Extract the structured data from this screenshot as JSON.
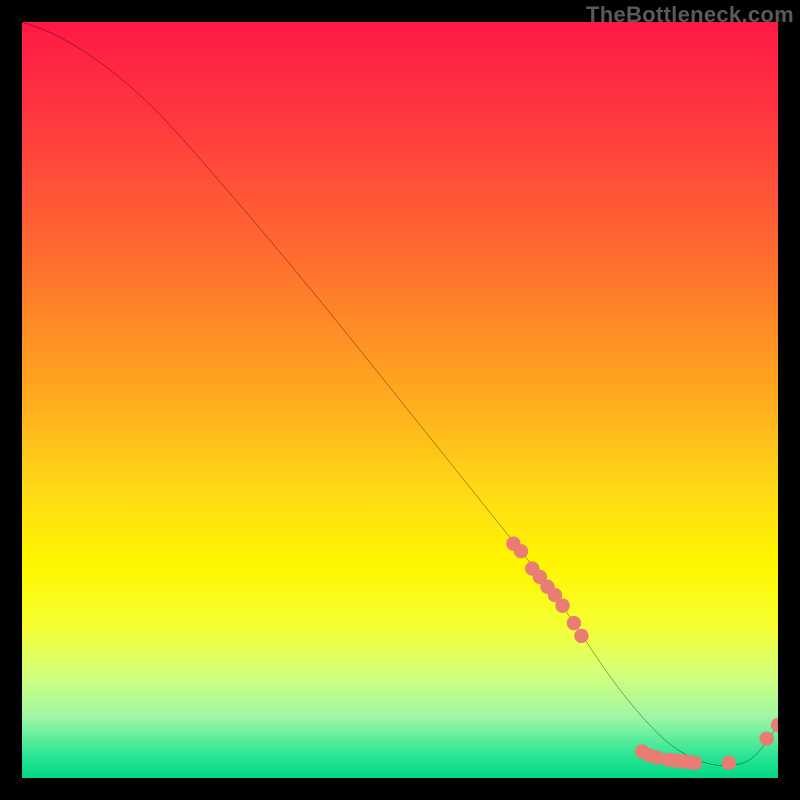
{
  "watermark": "TheBottleneck.com",
  "chart_data": {
    "type": "line",
    "title": "",
    "xlabel": "",
    "ylabel": "",
    "xlim": [
      0,
      100
    ],
    "ylim": [
      0,
      100
    ],
    "gradient_stops": [
      {
        "pct": 0,
        "color": "#ff1846"
      },
      {
        "pct": 14,
        "color": "#ff3b3e"
      },
      {
        "pct": 30,
        "color": "#ff6a30"
      },
      {
        "pct": 48,
        "color": "#ffa41f"
      },
      {
        "pct": 62,
        "color": "#ffd916"
      },
      {
        "pct": 72,
        "color": "#fff700"
      },
      {
        "pct": 80,
        "color": "#f5ff33"
      },
      {
        "pct": 86,
        "color": "#d6ff77"
      },
      {
        "pct": 92,
        "color": "#9ef7a4"
      },
      {
        "pct": 97,
        "color": "#2be594"
      },
      {
        "pct": 100,
        "color": "#00d885"
      }
    ],
    "series": [
      {
        "name": "bottleneck-curve",
        "color": "#000000",
        "x": [
          0,
          3,
          6,
          10,
          15,
          20,
          30,
          40,
          50,
          60,
          66,
          70,
          74,
          78,
          82,
          86,
          90,
          93,
          96,
          98,
          100
        ],
        "y": [
          100,
          99,
          97.5,
          95,
          91,
          86,
          74.5,
          62.5,
          50,
          37.5,
          30,
          25,
          19,
          13,
          8,
          4,
          2,
          1.5,
          2,
          4,
          7
        ]
      }
    ],
    "markers": {
      "name": "highlight-points",
      "color": "#e97c73",
      "radius": 6,
      "points": [
        {
          "x": 65.0,
          "y": 31.0
        },
        {
          "x": 66.0,
          "y": 30.0
        },
        {
          "x": 67.5,
          "y": 27.7
        },
        {
          "x": 68.5,
          "y": 26.6
        },
        {
          "x": 69.5,
          "y": 25.3
        },
        {
          "x": 70.5,
          "y": 24.2
        },
        {
          "x": 71.5,
          "y": 22.8
        },
        {
          "x": 73.0,
          "y": 20.5
        },
        {
          "x": 74.0,
          "y": 18.8
        },
        {
          "x": 82.0,
          "y": 3.5
        },
        {
          "x": 83.0,
          "y": 3.0
        },
        {
          "x": 84.0,
          "y": 2.7
        },
        {
          "x": 85.5,
          "y": 2.4
        },
        {
          "x": 86.5,
          "y": 2.3
        },
        {
          "x": 87.5,
          "y": 2.2
        },
        {
          "x": 88.3,
          "y": 2.1
        },
        {
          "x": 89.0,
          "y": 2.0
        },
        {
          "x": 93.5,
          "y": 2.0
        },
        {
          "x": 98.5,
          "y": 5.2
        },
        {
          "x": 100.0,
          "y": 7.0
        }
      ]
    }
  }
}
